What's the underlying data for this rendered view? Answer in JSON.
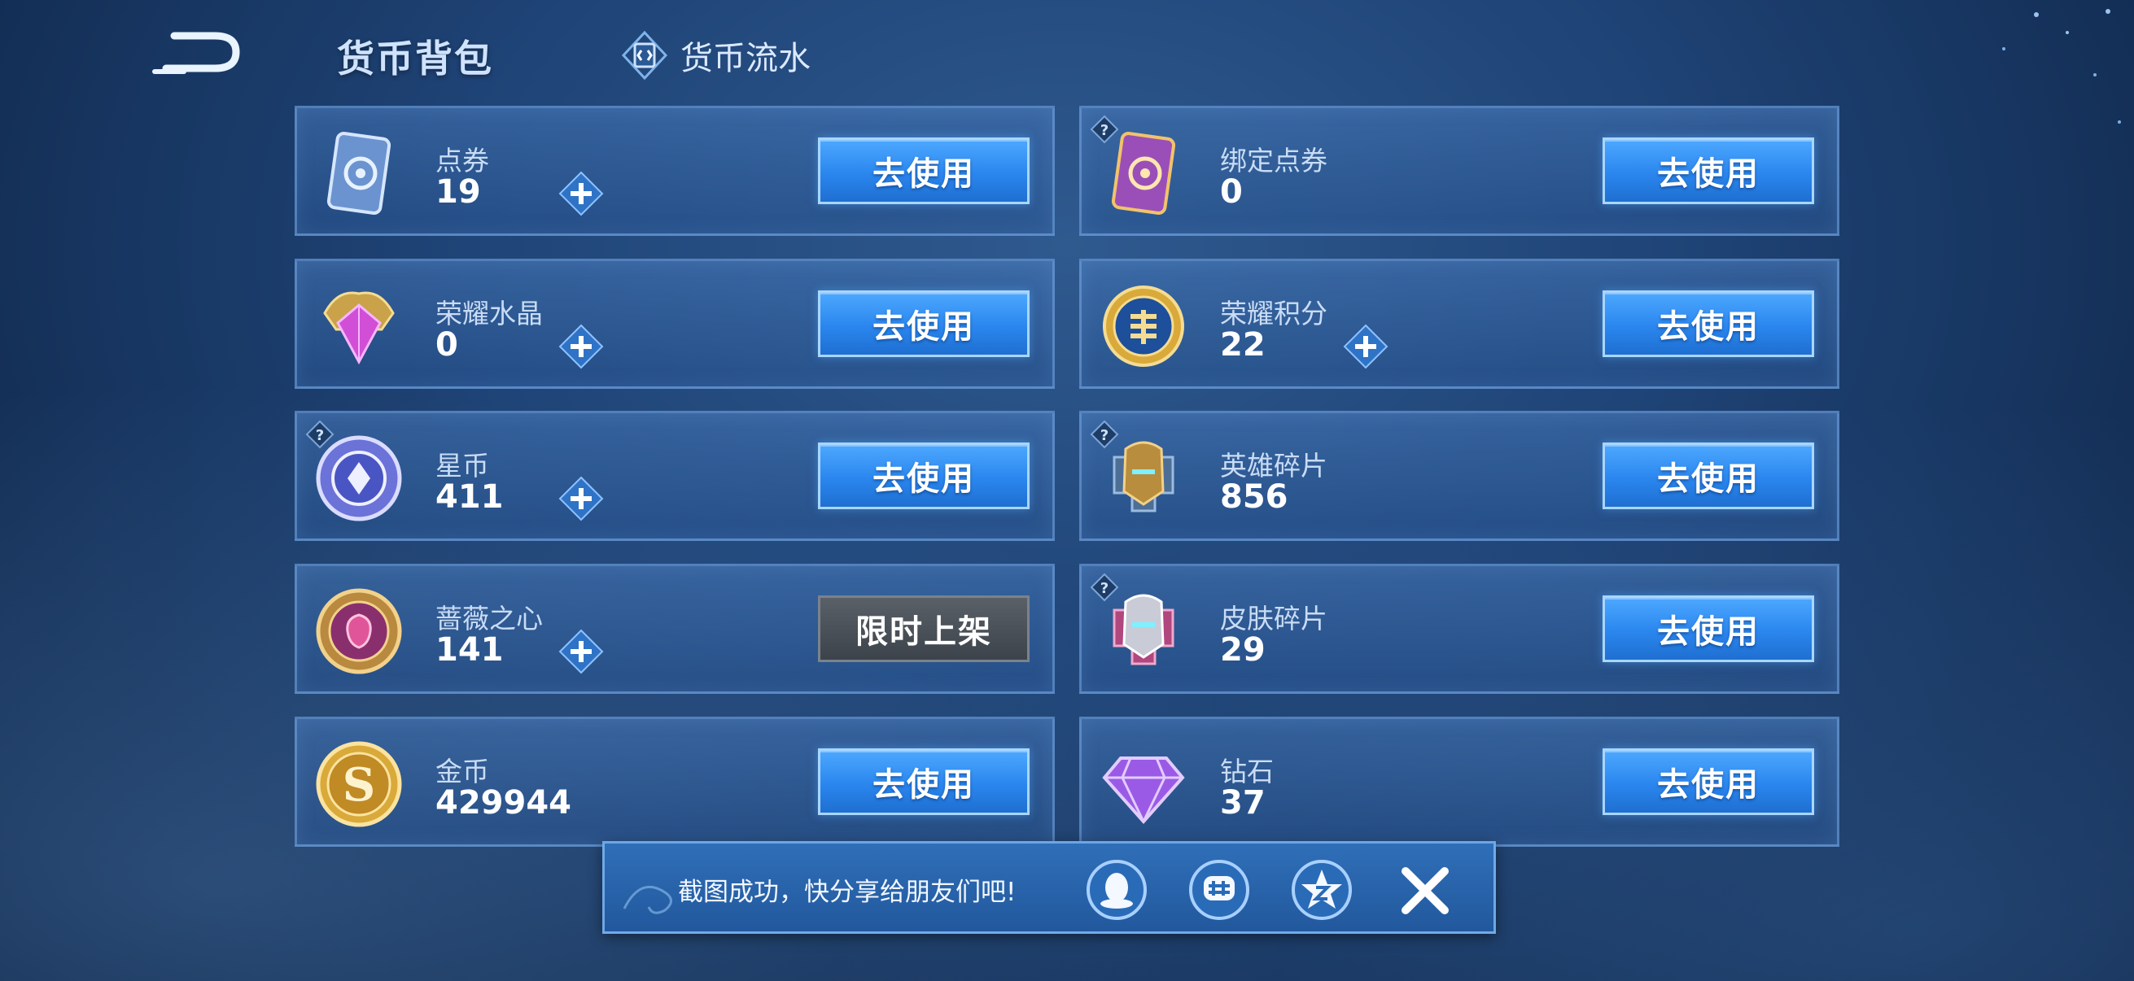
{
  "header": {
    "title": "货币背包",
    "flow_tab_label": "货币流水"
  },
  "currencies": [
    {
      "name": "点券",
      "value": "19",
      "button": "去使用"
    },
    {
      "name": "绑定点券",
      "value": "0",
      "button": "去使用"
    },
    {
      "name": "荣耀水晶",
      "value": "0",
      "button": "去使用"
    },
    {
      "name": "荣耀积分",
      "value": "22",
      "button": "去使用"
    },
    {
      "name": "星币",
      "value": "411",
      "button": "去使用"
    },
    {
      "name": "英雄碎片",
      "value": "856",
      "button": "去使用"
    },
    {
      "name": "蔷薇之心",
      "value": "141",
      "button": "限时上架"
    },
    {
      "name": "皮肤碎片",
      "value": "29",
      "button": "去使用"
    },
    {
      "name": "金币",
      "value": "429944",
      "button": "去使用"
    },
    {
      "name": "钻石",
      "value": "37",
      "button": "去使用"
    }
  ],
  "share_toast": {
    "message": "截图成功，快分享给朋友们吧!"
  }
}
